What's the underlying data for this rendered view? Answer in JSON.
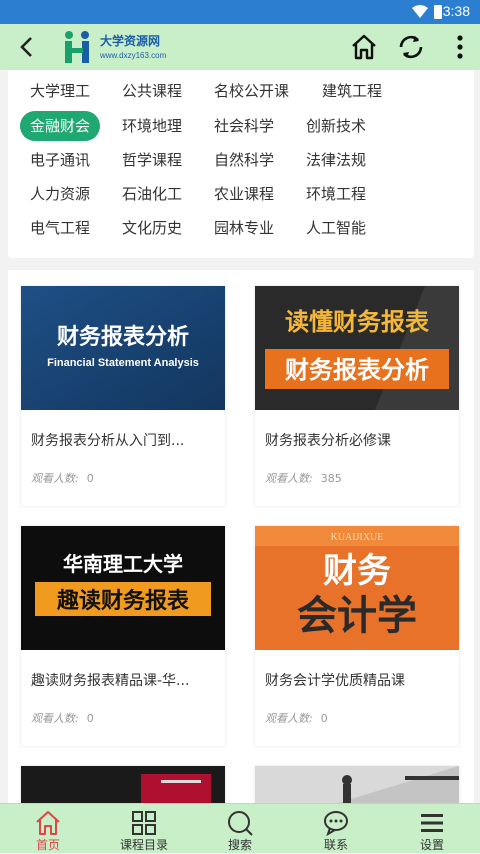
{
  "status_bar": {
    "time": "3:38"
  },
  "app_bar": {
    "logo_name": "大学资源网",
    "logo_url": "www.dxzy163.com",
    "icons": [
      "back-icon",
      "home-icon",
      "refresh-icon",
      "more-vert-icon"
    ]
  },
  "categories": [
    "大学理工",
    "公共课程",
    "名校公开课",
    "建筑工程",
    "金融财会",
    "环境地理",
    "社会科学",
    "创新技术",
    "电子通讯",
    "哲学课程",
    "自然科学",
    "法律法规",
    "人力资源",
    "石油化工",
    "农业课程",
    "环境工程",
    "电气工程",
    "文化历史",
    "园林专业",
    "人工智能"
  ],
  "active_category": "金融财会",
  "view_label": "观看人数:",
  "courses": [
    {
      "title": "财务报表分析从入门到...",
      "views": "0",
      "thumb_main": "财务报表分析",
      "thumb_sub": "Financial Statement Analysis"
    },
    {
      "title": "财务报表分析必修课",
      "views": "385",
      "thumb_main": "读懂财务报表",
      "thumb_sub": "财务报表分析"
    },
    {
      "title": "趣读财务报表精品课-华...",
      "views": "0",
      "thumb_main": "华南理工大学",
      "thumb_sub": "趣读财务报表"
    },
    {
      "title": "财务会计学优质精品课",
      "views": "0",
      "thumb_main": "财务",
      "thumb_sub": "会计学",
      "thumb_top": "KUAIJIXUE"
    }
  ],
  "tabs": [
    {
      "label": "首页",
      "icon": "home-icon"
    },
    {
      "label": "课程目录",
      "icon": "grid-icon"
    },
    {
      "label": "搜索",
      "icon": "search-icon"
    },
    {
      "label": "联系",
      "icon": "chat-icon"
    },
    {
      "label": "设置",
      "icon": "menu-icon"
    }
  ],
  "colors": {
    "accent": "#20a873",
    "app_bar": "#c8efc8",
    "status_bar": "#2c7fd0",
    "tab_active": "#e04545"
  }
}
